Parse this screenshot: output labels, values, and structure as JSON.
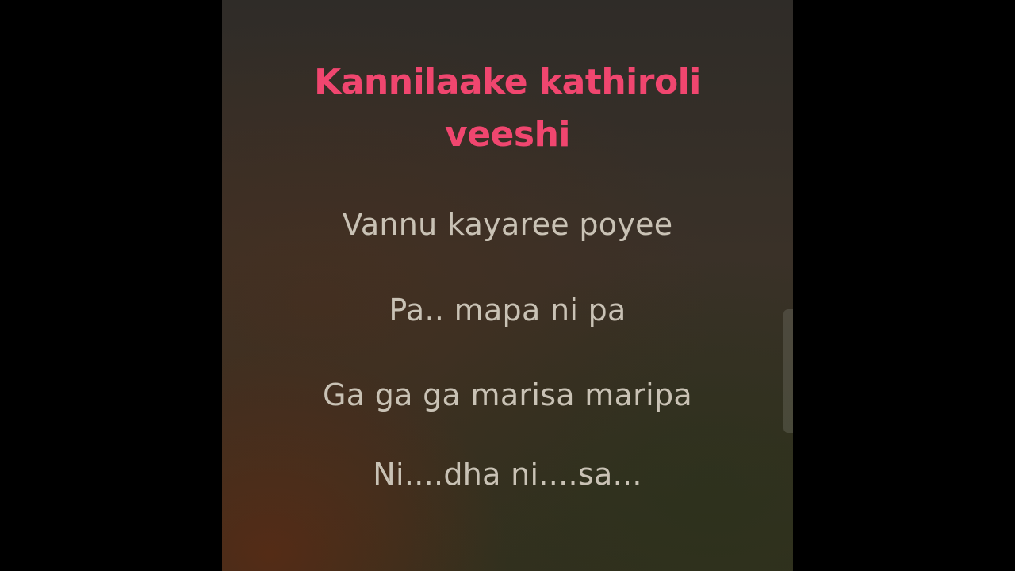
{
  "lyrics": {
    "current_line": {
      "row1": "Kannilaake kathiroli",
      "row2": "veeshi"
    },
    "lines": [
      "Vannu kayaree poyee",
      "Pa.. mapa ni pa",
      "Ga ga ga marisa maripa",
      "Ni....dha ni....sa..."
    ]
  },
  "colors": {
    "active_text": "#f0466f",
    "normal_text": "#c9c2b5",
    "letterbox": "#000000"
  }
}
